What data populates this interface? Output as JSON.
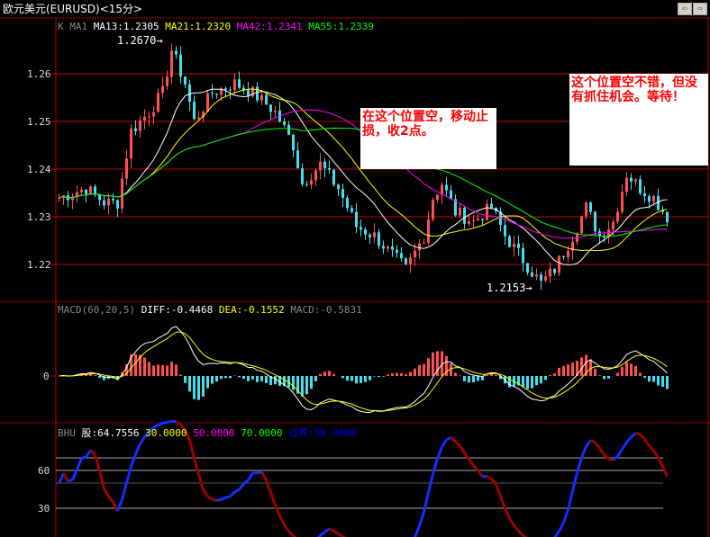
{
  "title": "欧元美元(EURUSD)<15分>",
  "nav": {
    "left": "⇦",
    "right": "⇨"
  },
  "main_legend": {
    "k": "K",
    "ma1": "MA1",
    "ma13": "MA13:1.2305",
    "ma21": "MA21:1.2320",
    "ma42": "MA42:1.2341",
    "ma55": "MA55:1.2339"
  },
  "macd_legend": {
    "name": "MACD(60,20,5)",
    "diff": "DIFF:-0.4468",
    "dea": "DEA:-0.1552",
    "macd": "MACD:-0.5831"
  },
  "bhu_legend": {
    "name": "BHU",
    "gu": "股:64.7556",
    "l30": "30.0000",
    "l50": "50.0000",
    "l70": "70.0000",
    "guojie": "过界:50.0000"
  },
  "annotations": {
    "high": "1.2670",
    "low": "1.2153",
    "note1": "在这个位置空，移动止损，收2点。",
    "note2": "这个位置空不错，但没有抓住机会。等待！"
  },
  "colors": {
    "up": "#ff5050",
    "down": "#40e0f0",
    "ma13": "#ffffff",
    "ma21": "#ffff00",
    "ma42": "#ff00ff",
    "ma55": "#00ff00",
    "grid": "#c00000"
  },
  "chart_data": [
    {
      "type": "candlestick",
      "title": "EURUSD 15min",
      "yticks": [
        "1.26",
        "1.25",
        "1.24",
        "1.23",
        "1.22"
      ],
      "ylim": [
        1.2115,
        1.2715
      ],
      "keypoints_bar_close": [
        [
          0,
          1.234
        ],
        [
          6,
          1.236
        ],
        [
          10,
          1.233
        ],
        [
          13,
          1.233
        ],
        [
          16,
          1.248
        ],
        [
          20,
          1.252
        ],
        [
          23,
          1.256
        ],
        [
          25,
          1.265
        ],
        [
          28,
          1.258
        ],
        [
          30,
          1.25
        ],
        [
          34,
          1.256
        ],
        [
          39,
          1.258
        ],
        [
          43,
          1.256
        ],
        [
          48,
          1.252
        ],
        [
          52,
          1.245
        ],
        [
          54,
          1.237
        ],
        [
          58,
          1.241
        ],
        [
          62,
          1.236
        ],
        [
          66,
          1.228
        ],
        [
          70,
          1.226
        ],
        [
          74,
          1.222
        ],
        [
          77,
          1.219
        ],
        [
          81,
          1.226
        ],
        [
          83,
          1.234
        ],
        [
          85,
          1.237
        ],
        [
          88,
          1.231
        ],
        [
          92,
          1.229
        ],
        [
          96,
          1.232
        ],
        [
          99,
          1.226
        ],
        [
          103,
          1.221
        ],
        [
          107,
          1.216
        ],
        [
          110,
          1.219
        ],
        [
          114,
          1.226
        ],
        [
          117,
          1.232
        ],
        [
          120,
          1.226
        ],
        [
          123,
          1.229
        ],
        [
          126,
          1.239
        ],
        [
          129,
          1.236
        ],
        [
          132,
          1.234
        ],
        [
          135,
          1.23
        ]
      ]
    },
    {
      "type": "line",
      "title": "MACD(60,20,5)",
      "yticks": [
        "0"
      ]
    },
    {
      "type": "line",
      "title": "BHU",
      "yticks": [
        "60",
        "30"
      ],
      "ylim": [
        0,
        100
      ]
    }
  ]
}
